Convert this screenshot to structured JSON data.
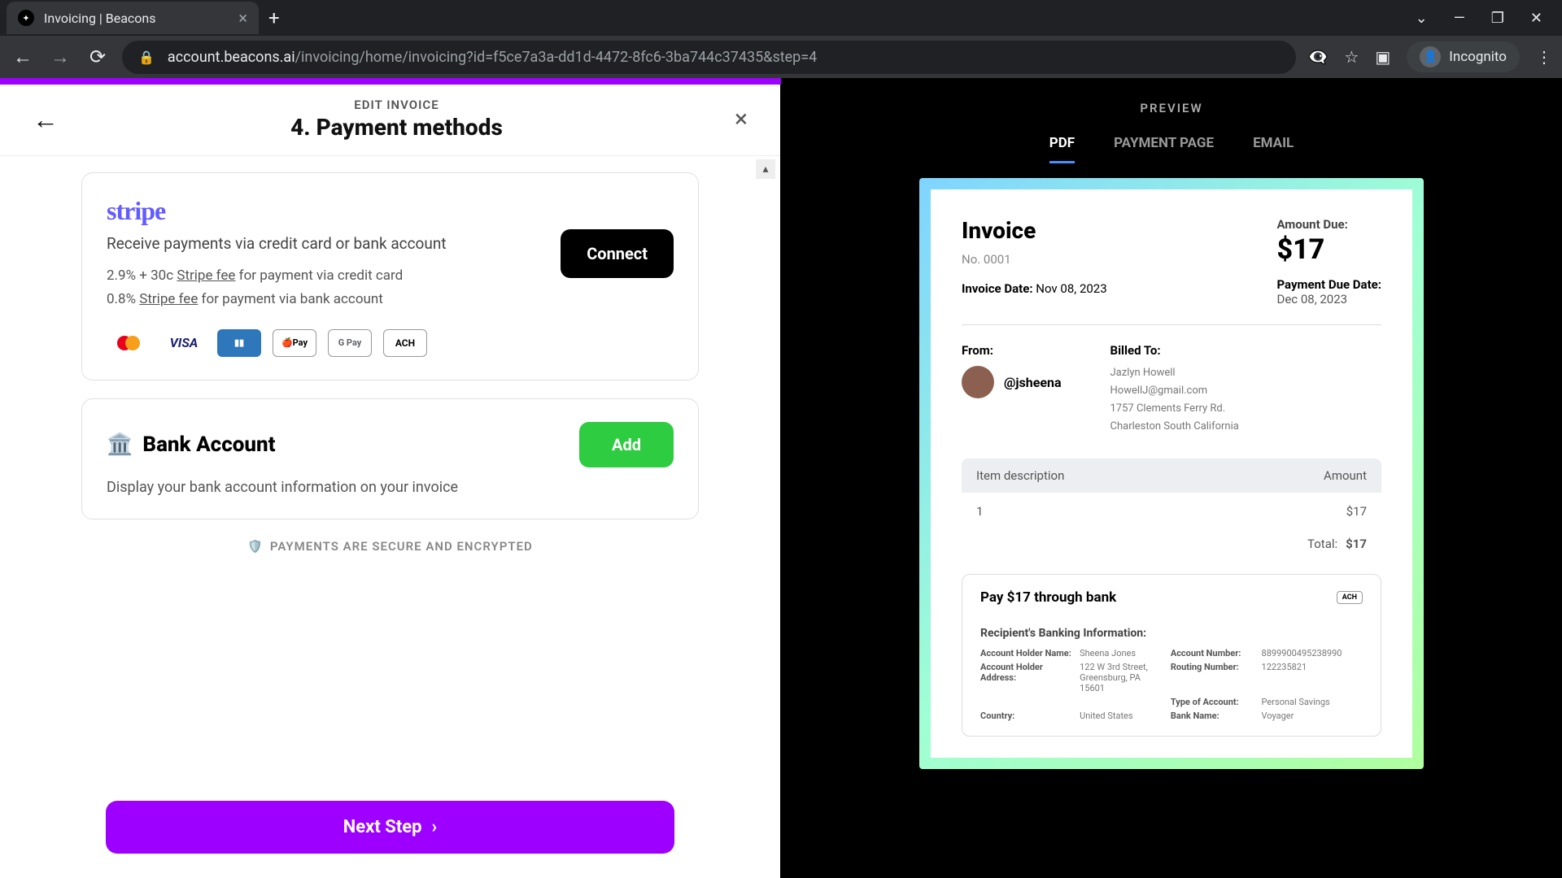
{
  "browser": {
    "tab_title": "Invoicing | Beacons",
    "url_host": "account.beacons.ai",
    "url_path": "/invoicing/home/invoicing?id=f5ce7a3a-dd1d-4472-8fc6-3ba744c37435&step=4",
    "incognito_label": "Incognito"
  },
  "editor": {
    "breadcrumb": "EDIT INVOICE",
    "title": "4. Payment methods",
    "stripe": {
      "logo_text": "stripe",
      "desc": "Receive payments via credit card or bank account",
      "fee_cc_pre": "2.9% + 30c ",
      "fee_link": "Stripe fee",
      "fee_cc_post": " for payment via credit card",
      "fee_bank_pre": "0.8% ",
      "fee_bank_post": " for payment via bank account",
      "connect_label": "Connect",
      "logo_visa": "VISA",
      "logo_apay": "🍎Pay",
      "logo_gpay": "G Pay",
      "logo_ach": "ACH"
    },
    "bank": {
      "title": "Bank Account",
      "desc": "Display your bank account information on your invoice",
      "add_label": "Add"
    },
    "secure_label": "PAYMENTS ARE SECURE AND ENCRYPTED",
    "next_label": "Next Step"
  },
  "preview": {
    "label": "PREVIEW",
    "tabs": {
      "pdf": "PDF",
      "page": "PAYMENT PAGE",
      "email": "EMAIL"
    },
    "invoice": {
      "title": "Invoice",
      "number": "No. 0001",
      "date_label": "Invoice Date:",
      "date_value": "Nov 08, 2023",
      "amount_due_label": "Amount Due:",
      "amount_due_value": "$17",
      "pay_due_label": "Payment Due Date:",
      "pay_due_value": "Dec 08, 2023",
      "from_label": "From:",
      "from_handle": "@jsheena",
      "billed_label": "Billed To:",
      "billed_name": "Jazlyn Howell",
      "billed_email": "HowellJ@gmail.com",
      "billed_addr1": "1757 Clements Ferry Rd.",
      "billed_addr2": "Charleston South California",
      "th_desc": "Item description",
      "th_amt": "Amount",
      "row_desc": "1",
      "row_amt": "$17",
      "total_label": "Total:",
      "total_value": "$17",
      "bank_pay_title": "Pay $17 through bank",
      "bank_ach": "ACH",
      "bank_sub": "Recipient's Banking Information:",
      "bg": {
        "l_holder": "Account Holder Name:",
        "v_holder": "Sheena Jones",
        "l_acct": "Account Number:",
        "v_acct": "8899900495238990",
        "l_addr": "Account Holder Address:",
        "v_addr": "122 W 3rd Street, Greensburg, PA 15601",
        "l_route": "Routing Number:",
        "v_route": "122235821",
        "l_type": "Type of Account:",
        "v_type": "Personal Savings",
        "l_country": "Country:",
        "v_country": "United States",
        "l_bank": "Bank Name:",
        "v_bank": "Voyager"
      }
    }
  }
}
